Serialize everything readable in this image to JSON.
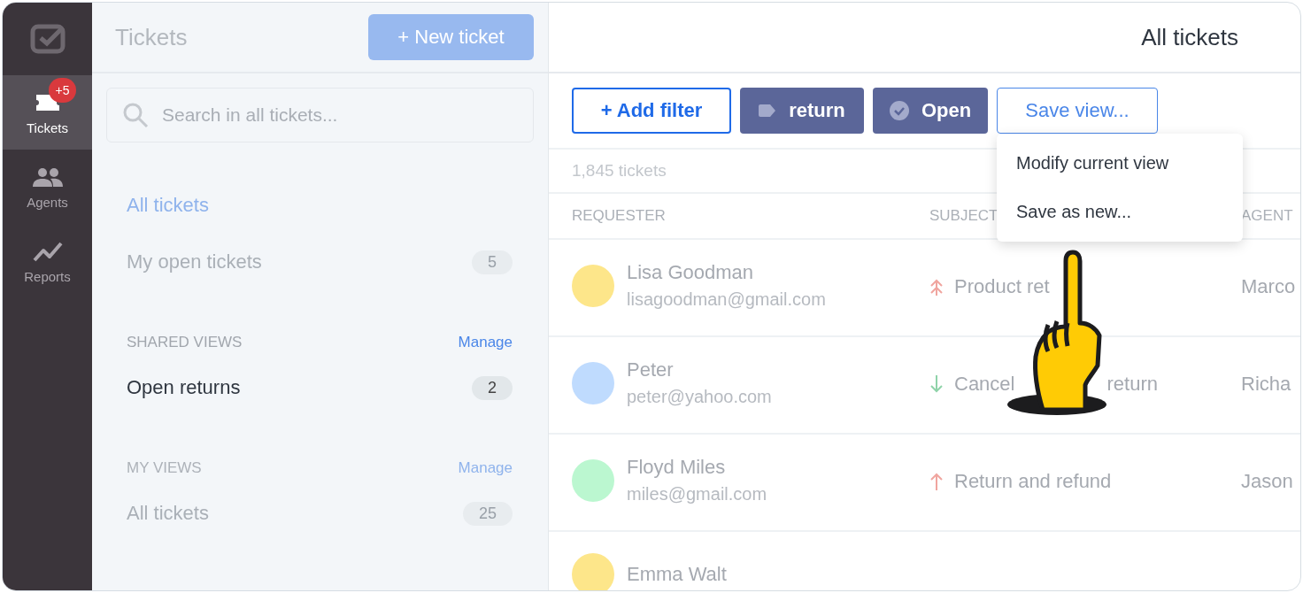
{
  "rail": {
    "items": [
      {
        "label": "Tickets",
        "selected": true,
        "badge": "+5"
      },
      {
        "label": "Agents",
        "selected": false
      },
      {
        "label": "Reports",
        "selected": false
      }
    ]
  },
  "panel": {
    "title": "Tickets",
    "new_button": "+ New ticket",
    "search": {
      "placeholder": "Search in all tickets..."
    },
    "sections": [
      {
        "dimmed": true,
        "items": [
          {
            "label": "All tickets",
            "selected": true
          },
          {
            "label": "My open tickets",
            "count": "5",
            "selected": false
          }
        ]
      },
      {
        "heading": "SHARED VIEWS",
        "manage": "Manage",
        "dimmed": false,
        "items": [
          {
            "label": "Open returns",
            "count": "2",
            "selected": false
          }
        ]
      },
      {
        "heading": "MY VIEWS",
        "manage": "Manage",
        "dimmed": true,
        "items": [
          {
            "label": "All tickets",
            "count": "25",
            "selected": false
          }
        ]
      }
    ]
  },
  "main": {
    "title": "All tickets",
    "filters": [
      {
        "kind": "add",
        "label": "+ Add filter"
      },
      {
        "kind": "tag",
        "label": "return"
      },
      {
        "kind": "status",
        "label": "Open"
      },
      {
        "kind": "save",
        "label": "Save view..."
      }
    ],
    "menu": [
      "Modify current view",
      "Save as new..."
    ],
    "count": "1,845 tickets",
    "columns": [
      "REQUESTER",
      "SUBJECT",
      "AGENT"
    ],
    "rows": [
      {
        "name": "Lisa Goodman",
        "email": "lisagoodman@gmail.com",
        "color": "#fde68a",
        "kind": "urgent",
        "subject": [
          "Product ret"
        ],
        "agent": "Marco"
      },
      {
        "name": "Peter",
        "email": "peter@yahoo.com",
        "color": "#bfdbfe",
        "kind": "low",
        "subject": [
          "Cancel",
          "return"
        ],
        "agent": "Richa"
      },
      {
        "name": "Floyd Miles",
        "email": "miles@gmail.com",
        "color": "#bbf7d0",
        "kind": "high",
        "subject": [
          "Return and refund"
        ],
        "agent": "Jason"
      },
      {
        "name": "Emma Walt",
        "color": "#fde68a"
      }
    ]
  }
}
